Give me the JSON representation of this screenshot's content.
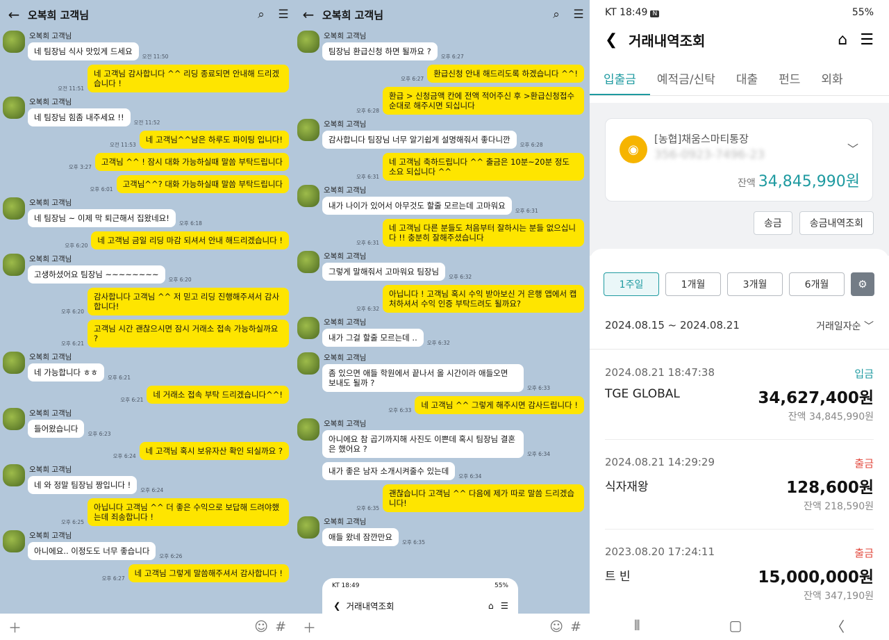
{
  "left_chat": {
    "title": "오복희 고객님",
    "sender": "오복희 고객님",
    "messages": [
      {
        "dir": "in",
        "text": "네 팀장님 식사 맛있게 드세요",
        "time": "오전 11:50",
        "head": true
      },
      {
        "dir": "out",
        "text": "네 고객님 감사합니다 ^^ 리딩 종료되면 안내해 드리겠습니다 !",
        "time": "오전 11:51"
      },
      {
        "dir": "in",
        "text": "네 팀장님 힘좀 내주세요 !!",
        "time": "오전 11:52",
        "head": true
      },
      {
        "dir": "out",
        "text": "네 고객님^^남은 하루도 파이팅 입니다!",
        "time": "오전 11:53"
      },
      {
        "dir": "out",
        "text": "고객님 ^^ ! 잠시 대화 가능하실때 말씀 부탁드립니다",
        "time": "오후 3:27"
      },
      {
        "dir": "out",
        "text": "고객님^^? 대화 가능하실때 말씀 부탁드립니다",
        "time": "오후 6:01"
      },
      {
        "dir": "in",
        "text": "네 팀장님 ~ 이제 막 퇴근해서 집왔네요!",
        "time": "오후 6:18",
        "head": true
      },
      {
        "dir": "out",
        "text": "네 고객님 금일 리딩 마감 되셔서 안내 해드리겠습니다 !",
        "time": "오후 6:20"
      },
      {
        "dir": "in",
        "text": "고생하셨어요 팀장님 ~~~~~~~~",
        "time": "오후 6:20",
        "head": true
      },
      {
        "dir": "out",
        "text": "감사합니다 고객님 ^^ 저 믿고 리딩 진행해주셔서 감사합니다!",
        "time": "오후 6:20"
      },
      {
        "dir": "out",
        "text": "고객님 시간 괜찮으시면 잠시 거래소 접속 가능하실까요 ?",
        "time": "오후 6:21"
      },
      {
        "dir": "in",
        "text": "네 가능합니다 ㅎㅎ",
        "time": "오후 6:21",
        "head": true
      },
      {
        "dir": "out",
        "text": "네 거래소 접속 부탁 드리겠습니다^^!",
        "time": "오후 6:21"
      },
      {
        "dir": "in",
        "text": "들어왔습니다",
        "time": "오후 6:23",
        "head": true
      },
      {
        "dir": "out",
        "text": "네 고객님 혹시 보유자산 확인 되실까요 ?",
        "time": "오후 6:24"
      },
      {
        "dir": "in",
        "text": "네 와 정말 팀장님 짱입니다 !",
        "time": "오후 6:24",
        "head": true
      },
      {
        "dir": "out",
        "text": "아닙니다 고객님 ^^ 더 좋은 수익으로 보답해 드려야했는데 죄송합니다 !",
        "time": "오후 6:25"
      },
      {
        "dir": "in",
        "text": "아니에요.. 이정도도 너무 좋습니다",
        "time": "오후 6:26",
        "head": true
      },
      {
        "dir": "out",
        "text": "네 고객님 그렇게 말씀해주셔서 감사합니다 !",
        "time": "오후 6:27"
      }
    ]
  },
  "mid_chat": {
    "title": "오복희 고객님",
    "sender": "오복희 고객님",
    "messages": [
      {
        "dir": "in",
        "text": "팀장님 환급신청 하면 될까요 ?",
        "time": "오후 6:27",
        "head": true
      },
      {
        "dir": "out",
        "text": "환급신청 안내 해드리도록 하겠습니다 ^^!",
        "time": "오후 6:27"
      },
      {
        "dir": "out",
        "text": "환급 > 신청금액 칸에 전액 적어주신 후 >환급신청접수 순대로 해주시면 되십니다",
        "time": "오후 6:28"
      },
      {
        "dir": "in",
        "text": "감사합니다 팀장님 너무 알기쉽게 설명해줘서 좋다니깐",
        "time": "오후 6:28",
        "head": true
      },
      {
        "dir": "out",
        "text": "네 고객님 축하드립니다 ^^ 출금은 10분~20분 정도 소요 되십니다 ^^",
        "time": "오후 6:31"
      },
      {
        "dir": "in",
        "text": "내가 나이가 있어서 아무것도 할줄 모르는데 고마워요",
        "time": "오후 6:31",
        "head": true
      },
      {
        "dir": "out",
        "text": "네 고객님 다른 분들도 처음부터 잘하시는 분들 없으십니다 !! 충분히 잘해주셨습니다",
        "time": "오후 6:31"
      },
      {
        "dir": "in",
        "text": "그렇게 말해줘서 고마워요 팀장님",
        "time": "오후 6:32",
        "head": true
      },
      {
        "dir": "out",
        "text": "아닙니다 ! 고객님 혹시 수익 받아보신 거 은행 앱에서 캡처하셔서 수익 인증 부탁드려도 될까요?",
        "time": "오후 6:32"
      },
      {
        "dir": "in",
        "text": "내가 그걸 할줄 모르는데 ..",
        "time": "오후 6:32",
        "head": true
      },
      {
        "dir": "in",
        "text": "좀 있으면 애들 학원에서 끝나서 올 시간이라 애들오면 보내도 될까 ?",
        "time": "오후 6:33",
        "head": true
      },
      {
        "dir": "out",
        "text": "네 고객님 ^^ 그렇게 해주시면 감사드립니다 !",
        "time": "오후 6:33"
      },
      {
        "dir": "in",
        "text": "아니에요 참 곱기까지해 사진도 이쁜데 혹시 팀장님 결혼은 했어요 ?",
        "time": "오후 6:34",
        "head": true
      },
      {
        "dir": "in",
        "text": "내가 좋은 남자 소개시켜줄수 있는데",
        "time": "오후 6:34"
      },
      {
        "dir": "out",
        "text": "괜찮습니다 고객님 ^^ 다음에 제가 따로 말씀 드리겠습니다!",
        "time": "오후 6:35"
      },
      {
        "dir": "in",
        "text": "애들 왔네 잠깐만요",
        "time": "오후 6:35",
        "head": true
      }
    ],
    "mini": {
      "status_time": "KT 18:49",
      "status_right": "55%",
      "title": "거래내역조회"
    }
  },
  "bank": {
    "status_left": "KT 18:49",
    "status_right": "55%",
    "title": "거래내역조회",
    "tabs": [
      "입출금",
      "예적금/신탁",
      "대출",
      "펀드",
      "외화"
    ],
    "account_name": "[농협]채움스마티통장",
    "account_number": "356-0923-7496-23",
    "balance_label": "잔액",
    "balance": "34,845,990원",
    "btn_send": "송금",
    "btn_history": "송금내역조회",
    "periods": [
      "1주일",
      "1개월",
      "3개월",
      "6개월"
    ],
    "range": "2024.08.15 ~ 2024.08.21",
    "sort": "거래일자순",
    "transactions": [
      {
        "date": "2024.08.21 18:47:38",
        "type": "입금",
        "name": "TGE GLOBAL",
        "amount": "34,627,400원",
        "balance": "잔액 34,845,990원"
      },
      {
        "date": "2024.08.21 14:29:29",
        "type": "출금",
        "name": "식자재왕",
        "amount": "128,600원",
        "balance": "잔액 218,590원"
      },
      {
        "date": "2023.08.20 17:24:11",
        "type": "출금",
        "name": "트 빈",
        "amount": "15,000,000원",
        "balance": "잔액 347,190원"
      }
    ],
    "colors": {
      "accent": "#1e9aa0",
      "deposit": "#1e9aa0",
      "withdraw": "#e2483d"
    }
  }
}
